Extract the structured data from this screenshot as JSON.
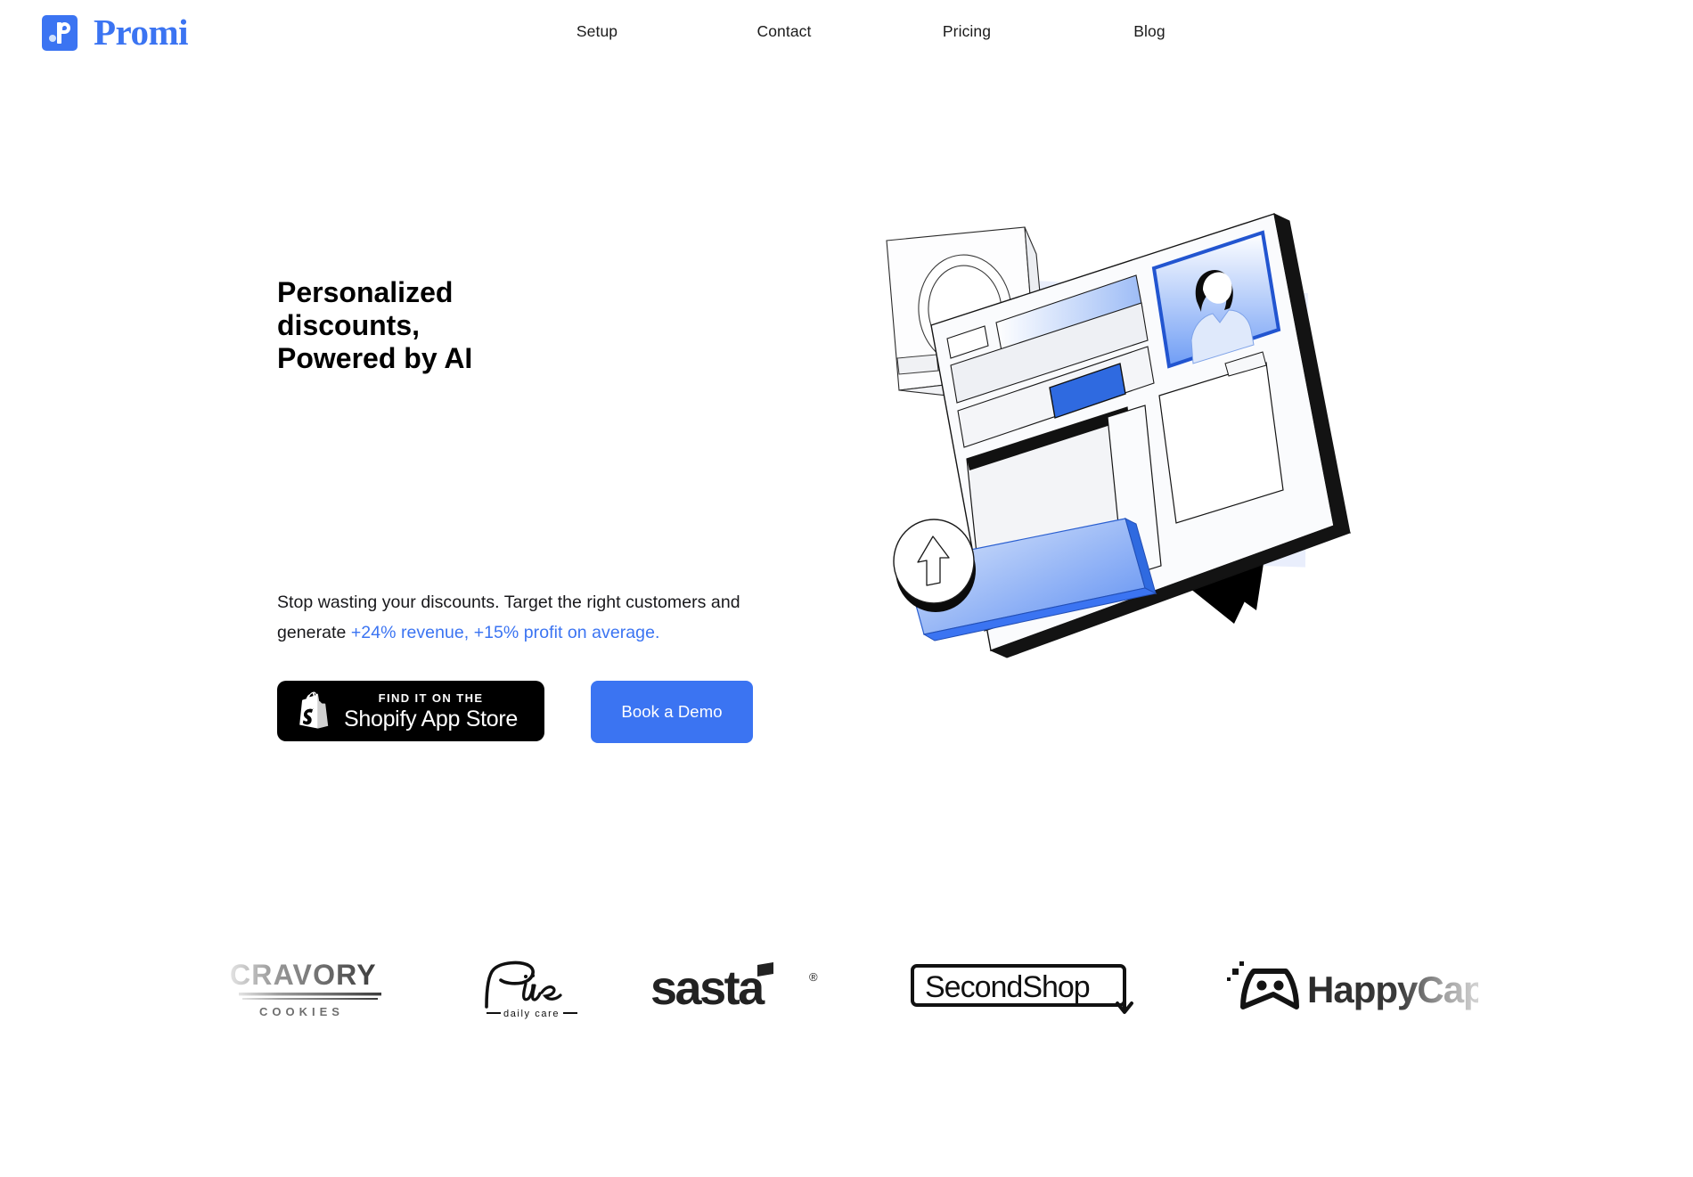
{
  "brand": {
    "name": "Promi",
    "mark_icon": "promi-p-logo-icon",
    "color": "#3b74f2"
  },
  "nav": {
    "items": [
      {
        "label": "Setup"
      },
      {
        "label": "Contact"
      },
      {
        "label": "Pricing"
      },
      {
        "label": "Blog"
      }
    ]
  },
  "hero": {
    "headline_line1": "Personalized",
    "headline_line2": "discounts,",
    "headline_line3_accent": "Powered by AI",
    "sub_part1": "Stop wasting your discounts. Target the right customers and generate ",
    "sub_highlight": "+24% revenue, +15% profit on average.",
    "shopify_button": {
      "eyebrow": "FIND IT ON THE",
      "label": "Shopify App Store",
      "icon": "shopify-bag-icon",
      "background": "#000000"
    },
    "demo_button": {
      "label": "Book a Demo",
      "background": "#3b74f2"
    },
    "illustration": {
      "name": "isometric-dashboard-illustration",
      "accent_blue": "#2f6ae0",
      "panel_tint": "#e8eefc",
      "shadow": "#000000"
    }
  },
  "logos": {
    "items": [
      {
        "name": "cravory-cookies-logo",
        "title": "CRAVORY",
        "subtitle": "C O O K I E S"
      },
      {
        "name": "pure-daily-care-logo",
        "title": "Pure",
        "subtitle": "daily care"
      },
      {
        "name": "sasta-logo",
        "title": "sasta",
        "subtitle": "®"
      },
      {
        "name": "secondshop-logo",
        "title": "SecondShop",
        "subtitle": ""
      },
      {
        "name": "happycap-logo",
        "title": "HappyCap",
        "subtitle": ""
      }
    ]
  }
}
